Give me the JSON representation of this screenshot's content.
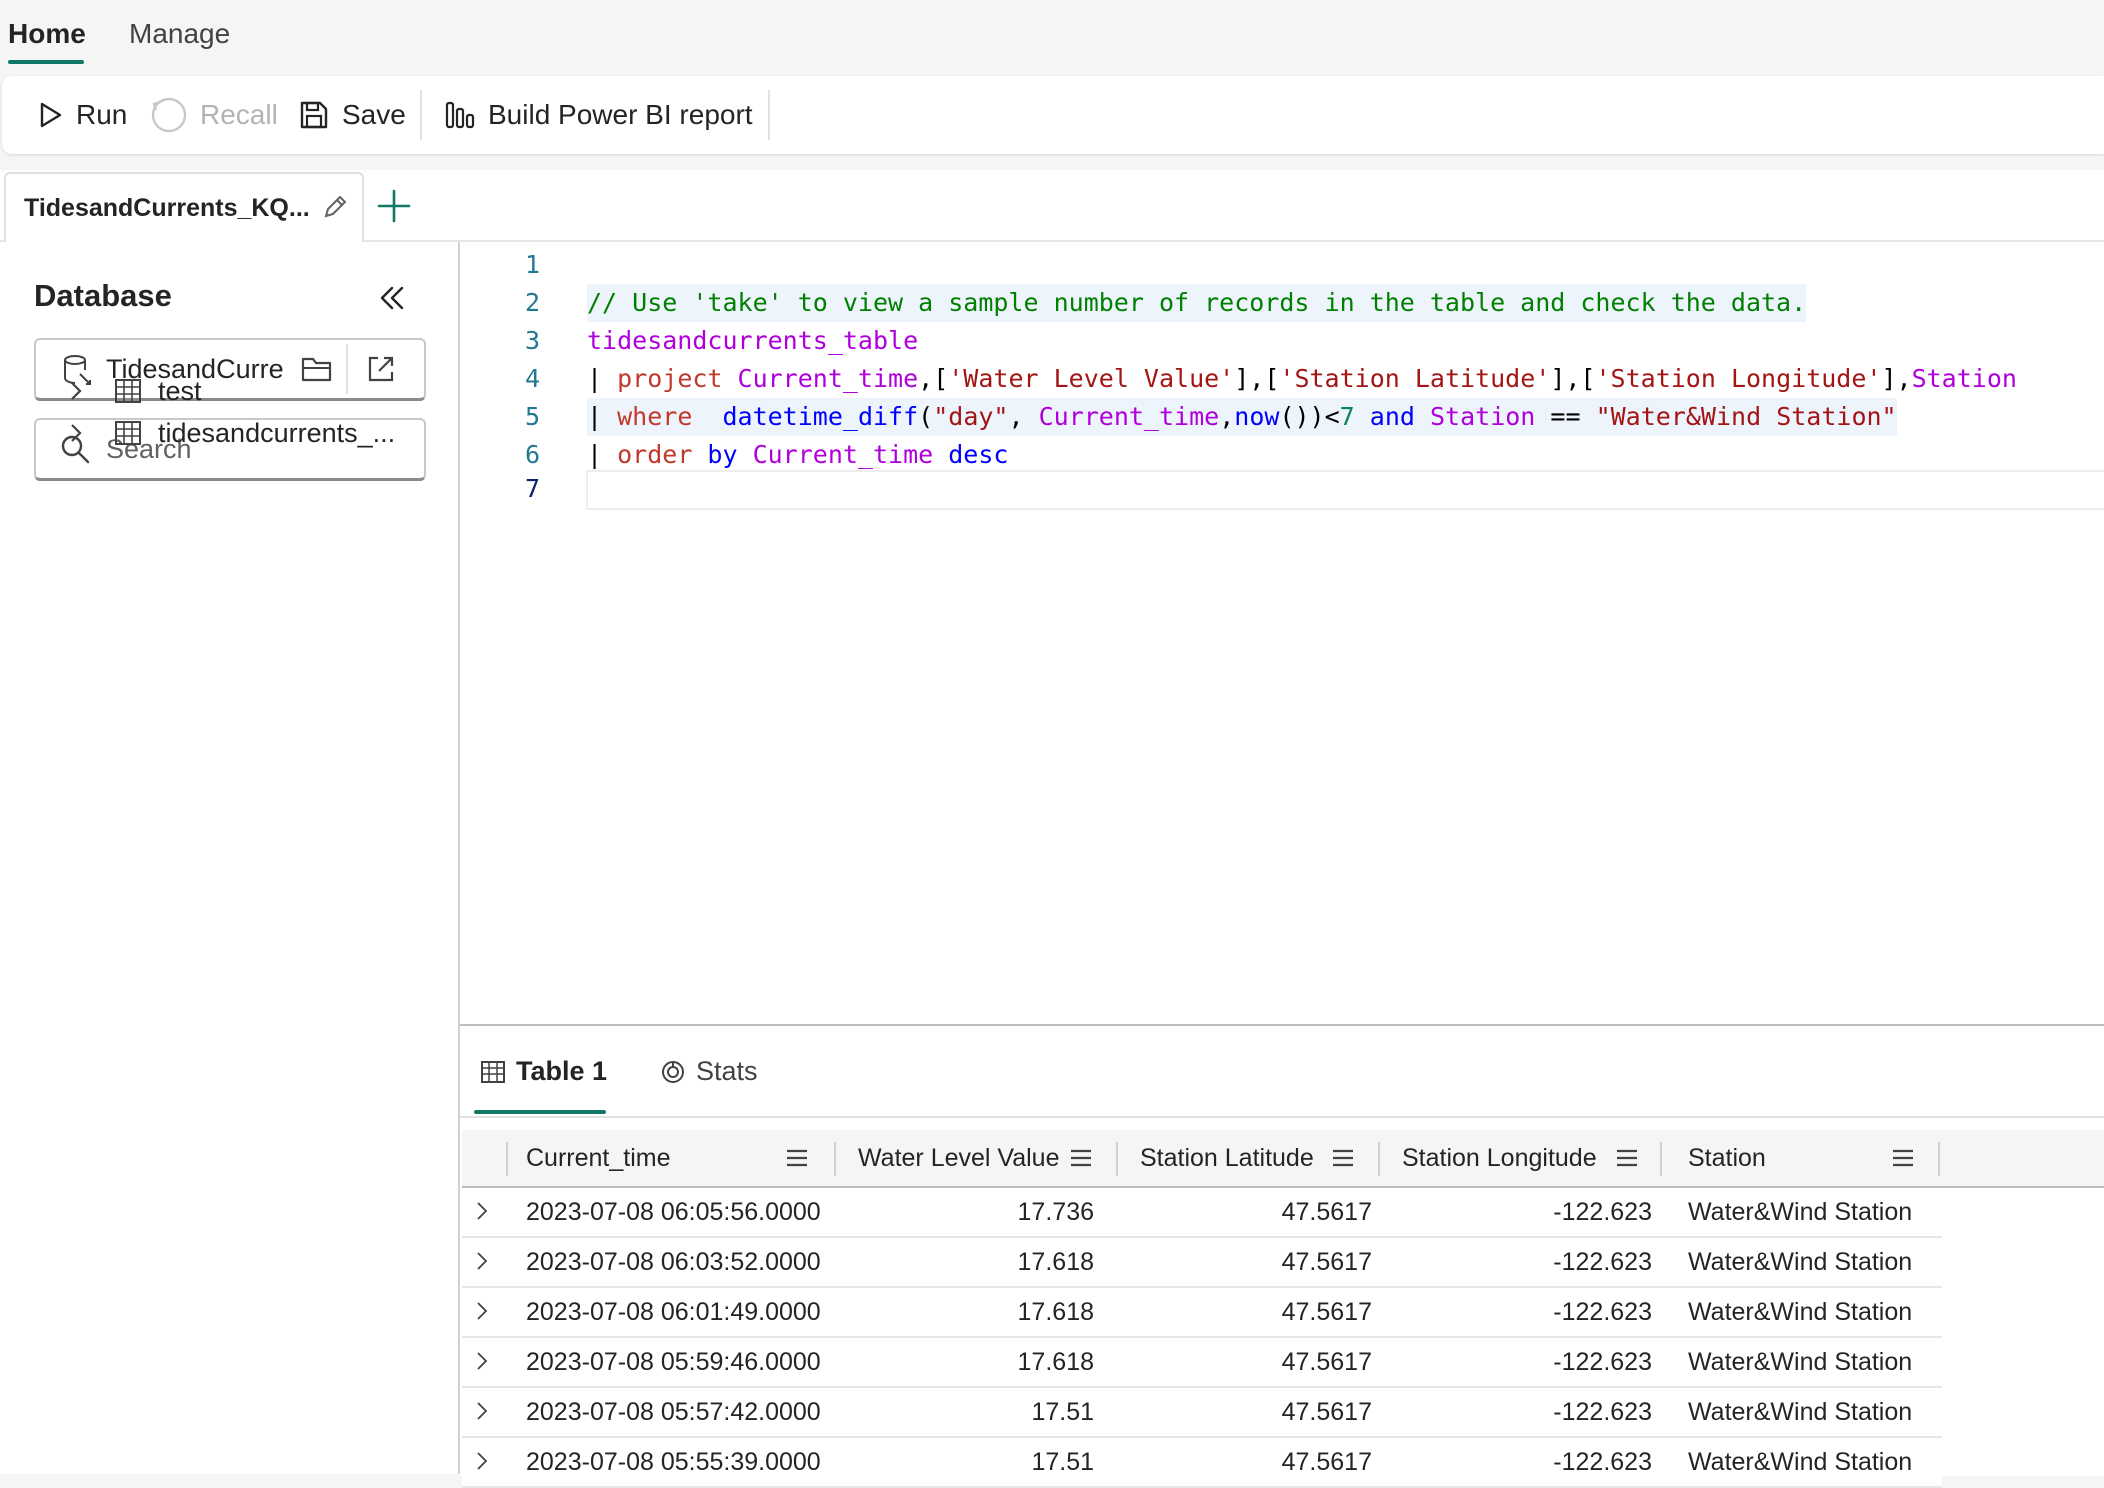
{
  "ribbon": {
    "tabs": [
      "Home",
      "Manage"
    ]
  },
  "toolbar": {
    "run_label": "Run",
    "recall_label": "Recall",
    "save_label": "Save",
    "powerbi_label": "Build Power BI report"
  },
  "query_tab": {
    "label": "TidesandCurrents_KQ..."
  },
  "sidebar": {
    "title": "Database",
    "database_name": "TidesandCurre",
    "search_placeholder": "Search",
    "tables": [
      "test",
      "tidesandcurrents_..."
    ]
  },
  "editor": {
    "line_numbers": [
      "1",
      "2",
      "3",
      "4",
      "5",
      "6",
      "7"
    ],
    "code": {
      "comment": "// Use 'take' to view a sample number of records in the table and check the data.",
      "table": "tidesandcurrents_table",
      "l4_pipe": "| ",
      "l4_kw": "project",
      "l4_rest_a": " Current_time",
      "l4_p1": ",[",
      "l4_s1": "'Water Level Value'",
      "l4_p2": "],[",
      "l4_s2": "'Station Latitude'",
      "l4_p3": "],[",
      "l4_s3": "'Station Longitude'",
      "l4_p4": "],",
      "l4_station": "Station",
      "l5_pipe": "| ",
      "l5_kw": "where",
      "l5_fn": "  datetime_diff",
      "l5_p1": "(",
      "l5_s1": "\"day\"",
      "l5_p2": ", ",
      "l5_id1": "Current_time",
      "l5_p3": ",",
      "l5_fn2": "now",
      "l5_p4": "())<",
      "l5_num": "7",
      "l5_and": " and",
      "l5_id2": " Station",
      "l5_eq": " == ",
      "l5_s2": "\"Water&Wind Station\"",
      "l6_pipe": "| ",
      "l6_kw": "order",
      "l6_by": " by",
      "l6_id": " Current_time",
      "l6_desc": " desc"
    }
  },
  "results": {
    "tabs": [
      "Table 1",
      "Stats"
    ],
    "columns": [
      "Current_time",
      "Water Level Value",
      "Station Latitude",
      "Station Longitude",
      "Station"
    ],
    "rows": [
      [
        "2023-07-08 06:05:56.0000",
        "17.736",
        "47.5617",
        "-122.623",
        "Water&Wind Station"
      ],
      [
        "2023-07-08 06:03:52.0000",
        "17.618",
        "47.5617",
        "-122.623",
        "Water&Wind Station"
      ],
      [
        "2023-07-08 06:01:49.0000",
        "17.618",
        "47.5617",
        "-122.623",
        "Water&Wind Station"
      ],
      [
        "2023-07-08 05:59:46.0000",
        "17.618",
        "47.5617",
        "-122.623",
        "Water&Wind Station"
      ],
      [
        "2023-07-08 05:57:42.0000",
        "17.51",
        "47.5617",
        "-122.623",
        "Water&Wind Station"
      ],
      [
        "2023-07-08 05:55:39.0000",
        "17.51",
        "47.5617",
        "-122.623",
        "Water&Wind Station"
      ]
    ]
  },
  "colors": {
    "accent": "#117865",
    "comment": "#008000",
    "keyword": "#c0392b",
    "string": "#a31515"
  }
}
